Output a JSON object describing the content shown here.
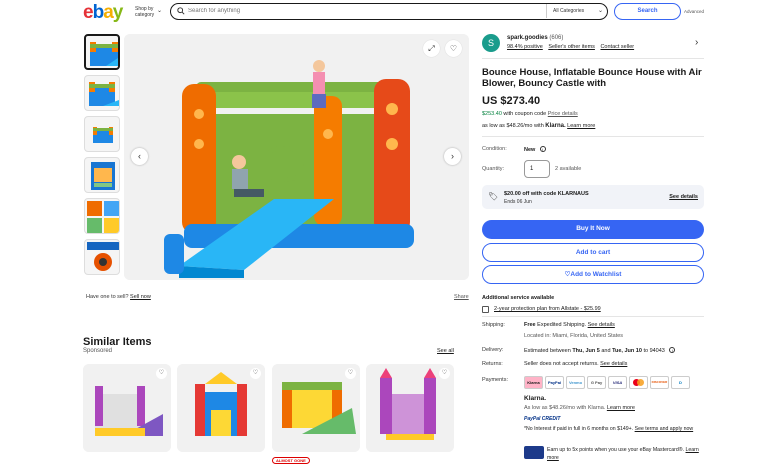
{
  "header": {
    "logo": [
      "e",
      "b",
      "a",
      "y"
    ],
    "shop_by_line1": "Shop by",
    "shop_by_line2": "category",
    "search_placeholder": "Search for anything",
    "category": "All Categories",
    "search_button": "Search",
    "advanced": "Advanced"
  },
  "gallery": {
    "thumb_count": 6,
    "have_one": "Have one to sell?",
    "sell_now": "Sell now",
    "share": "Share"
  },
  "similar": {
    "title": "Similar Items",
    "subtitle": "Sponsored",
    "see_all": "See all",
    "badge": "ALMOST GONE"
  },
  "seller": {
    "initial": "S",
    "name": "spark.goodies",
    "count": "(606)",
    "positive": "98.4% positive",
    "other_items": "Seller's other items",
    "contact": "Contact seller"
  },
  "listing": {
    "title": "Bounce House, Inflatable Bounce House with Air Blower, Bouncy Castle with",
    "price": "US $273.40",
    "coupon_price": "$253.40",
    "coupon_text": "with coupon code",
    "price_details": "Price details",
    "low_as": "as low as $48.26/mo with",
    "klarna": "Klarna.",
    "learn_more": "Learn more",
    "condition_label": "Condition:",
    "condition": "New",
    "quantity_label": "Quantity:",
    "quantity": "1",
    "available": "2 available",
    "promo_title": "$20.00 off with code KLARNAUS",
    "promo_ends": "Ends 06 Jun",
    "see_details": "See details",
    "buy_now": "Buy It Now",
    "add_cart": "Add to cart",
    "add_watchlist": "Add to Watchlist"
  },
  "service": {
    "title": "Additional service available",
    "plan": "2-year protection plan from Allstate - $25.99"
  },
  "shipping": {
    "label": "Shipping:",
    "free": "Free",
    "text": "Expedited Shipping.",
    "details": "See details",
    "location": "Located in: Miami, Florida, United States"
  },
  "delivery": {
    "label": "Delivery:",
    "pre": "Estimated between",
    "dates": "Thu, Jun 5",
    "and": "and",
    "dates2": "Tue, Jun 10",
    "zip": "to 94043"
  },
  "returns": {
    "label": "Returns:",
    "text": "Seller does not accept returns.",
    "details": "See details"
  },
  "payments": {
    "label": "Payments:",
    "methods": [
      "Klarna",
      "PayPal",
      "Venmo",
      "G Pay",
      "VISA",
      "MC",
      "DISCOVER",
      "D"
    ],
    "klarna_logo": "Klarna.",
    "klarna_text": "As low as $48.26/mo with Klarna.",
    "learn_more": "Learn more",
    "pp_credit": "PayPal CREDIT",
    "pp_text": "*No Interest if paid in full in 6 months on $149+.",
    "pp_terms": "See terms and apply now",
    "mc_text": "Earn up to 5x points when you use your eBay Mastercard®.",
    "mc_learn": "Learn more"
  },
  "colors": {
    "accent": "#3665f3",
    "green": "#05823f",
    "seller_avatar": "#1a9c8c"
  }
}
